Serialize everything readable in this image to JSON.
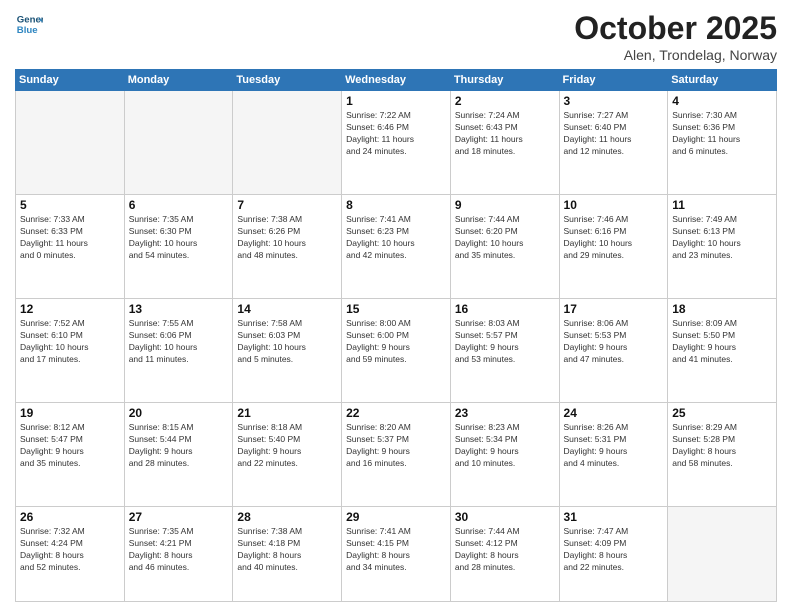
{
  "header": {
    "logo_line1": "General",
    "logo_line2": "Blue",
    "month_title": "October 2025",
    "location": "Alen, Trondelag, Norway"
  },
  "weekdays": [
    "Sunday",
    "Monday",
    "Tuesday",
    "Wednesday",
    "Thursday",
    "Friday",
    "Saturday"
  ],
  "weeks": [
    [
      {
        "day": "",
        "info": ""
      },
      {
        "day": "",
        "info": ""
      },
      {
        "day": "",
        "info": ""
      },
      {
        "day": "1",
        "info": "Sunrise: 7:22 AM\nSunset: 6:46 PM\nDaylight: 11 hours\nand 24 minutes."
      },
      {
        "day": "2",
        "info": "Sunrise: 7:24 AM\nSunset: 6:43 PM\nDaylight: 11 hours\nand 18 minutes."
      },
      {
        "day": "3",
        "info": "Sunrise: 7:27 AM\nSunset: 6:40 PM\nDaylight: 11 hours\nand 12 minutes."
      },
      {
        "day": "4",
        "info": "Sunrise: 7:30 AM\nSunset: 6:36 PM\nDaylight: 11 hours\nand 6 minutes."
      }
    ],
    [
      {
        "day": "5",
        "info": "Sunrise: 7:33 AM\nSunset: 6:33 PM\nDaylight: 11 hours\nand 0 minutes."
      },
      {
        "day": "6",
        "info": "Sunrise: 7:35 AM\nSunset: 6:30 PM\nDaylight: 10 hours\nand 54 minutes."
      },
      {
        "day": "7",
        "info": "Sunrise: 7:38 AM\nSunset: 6:26 PM\nDaylight: 10 hours\nand 48 minutes."
      },
      {
        "day": "8",
        "info": "Sunrise: 7:41 AM\nSunset: 6:23 PM\nDaylight: 10 hours\nand 42 minutes."
      },
      {
        "day": "9",
        "info": "Sunrise: 7:44 AM\nSunset: 6:20 PM\nDaylight: 10 hours\nand 35 minutes."
      },
      {
        "day": "10",
        "info": "Sunrise: 7:46 AM\nSunset: 6:16 PM\nDaylight: 10 hours\nand 29 minutes."
      },
      {
        "day": "11",
        "info": "Sunrise: 7:49 AM\nSunset: 6:13 PM\nDaylight: 10 hours\nand 23 minutes."
      }
    ],
    [
      {
        "day": "12",
        "info": "Sunrise: 7:52 AM\nSunset: 6:10 PM\nDaylight: 10 hours\nand 17 minutes."
      },
      {
        "day": "13",
        "info": "Sunrise: 7:55 AM\nSunset: 6:06 PM\nDaylight: 10 hours\nand 11 minutes."
      },
      {
        "day": "14",
        "info": "Sunrise: 7:58 AM\nSunset: 6:03 PM\nDaylight: 10 hours\nand 5 minutes."
      },
      {
        "day": "15",
        "info": "Sunrise: 8:00 AM\nSunset: 6:00 PM\nDaylight: 9 hours\nand 59 minutes."
      },
      {
        "day": "16",
        "info": "Sunrise: 8:03 AM\nSunset: 5:57 PM\nDaylight: 9 hours\nand 53 minutes."
      },
      {
        "day": "17",
        "info": "Sunrise: 8:06 AM\nSunset: 5:53 PM\nDaylight: 9 hours\nand 47 minutes."
      },
      {
        "day": "18",
        "info": "Sunrise: 8:09 AM\nSunset: 5:50 PM\nDaylight: 9 hours\nand 41 minutes."
      }
    ],
    [
      {
        "day": "19",
        "info": "Sunrise: 8:12 AM\nSunset: 5:47 PM\nDaylight: 9 hours\nand 35 minutes."
      },
      {
        "day": "20",
        "info": "Sunrise: 8:15 AM\nSunset: 5:44 PM\nDaylight: 9 hours\nand 28 minutes."
      },
      {
        "day": "21",
        "info": "Sunrise: 8:18 AM\nSunset: 5:40 PM\nDaylight: 9 hours\nand 22 minutes."
      },
      {
        "day": "22",
        "info": "Sunrise: 8:20 AM\nSunset: 5:37 PM\nDaylight: 9 hours\nand 16 minutes."
      },
      {
        "day": "23",
        "info": "Sunrise: 8:23 AM\nSunset: 5:34 PM\nDaylight: 9 hours\nand 10 minutes."
      },
      {
        "day": "24",
        "info": "Sunrise: 8:26 AM\nSunset: 5:31 PM\nDaylight: 9 hours\nand 4 minutes."
      },
      {
        "day": "25",
        "info": "Sunrise: 8:29 AM\nSunset: 5:28 PM\nDaylight: 8 hours\nand 58 minutes."
      }
    ],
    [
      {
        "day": "26",
        "info": "Sunrise: 7:32 AM\nSunset: 4:24 PM\nDaylight: 8 hours\nand 52 minutes."
      },
      {
        "day": "27",
        "info": "Sunrise: 7:35 AM\nSunset: 4:21 PM\nDaylight: 8 hours\nand 46 minutes."
      },
      {
        "day": "28",
        "info": "Sunrise: 7:38 AM\nSunset: 4:18 PM\nDaylight: 8 hours\nand 40 minutes."
      },
      {
        "day": "29",
        "info": "Sunrise: 7:41 AM\nSunset: 4:15 PM\nDaylight: 8 hours\nand 34 minutes."
      },
      {
        "day": "30",
        "info": "Sunrise: 7:44 AM\nSunset: 4:12 PM\nDaylight: 8 hours\nand 28 minutes."
      },
      {
        "day": "31",
        "info": "Sunrise: 7:47 AM\nSunset: 4:09 PM\nDaylight: 8 hours\nand 22 minutes."
      },
      {
        "day": "",
        "info": ""
      }
    ]
  ]
}
